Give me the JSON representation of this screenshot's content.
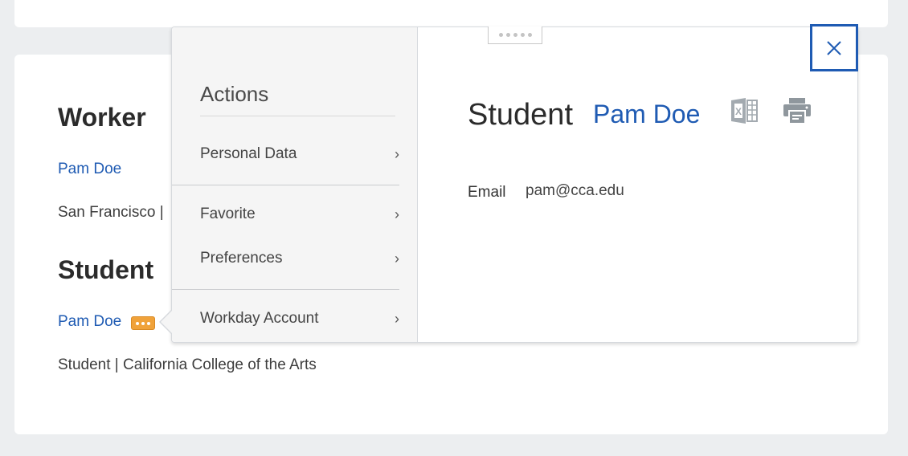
{
  "page": {
    "worker_section": {
      "title": "Worker",
      "name": "Pam Doe",
      "subtext": "San Francisco |"
    },
    "student_section": {
      "title": "Student",
      "name": "Pam Doe",
      "subtext": "Student | California College of the Arts",
      "related_actions_icon": "more-dots-icon"
    }
  },
  "popup": {
    "actions": {
      "title": "Actions",
      "items": [
        {
          "label": "Personal Data",
          "icon": "chevron-right-icon"
        },
        {
          "label": "Favorite",
          "icon": "chevron-right-icon"
        },
        {
          "label": "Preferences",
          "icon": "chevron-right-icon"
        },
        {
          "label": "Workday Account",
          "icon": "chevron-right-icon"
        }
      ],
      "chevron": "›"
    },
    "detail": {
      "title": "Student",
      "name": "Pam Doe",
      "fields": [
        {
          "label": "Email",
          "value": "pam@cca.edu"
        }
      ],
      "excel_icon": "excel-export-icon",
      "print_icon": "printer-icon"
    },
    "close_icon": "close-icon"
  },
  "colors": {
    "link": "#1f5bb3",
    "accent_orange": "#f0a23a",
    "background": "#eceef0"
  }
}
